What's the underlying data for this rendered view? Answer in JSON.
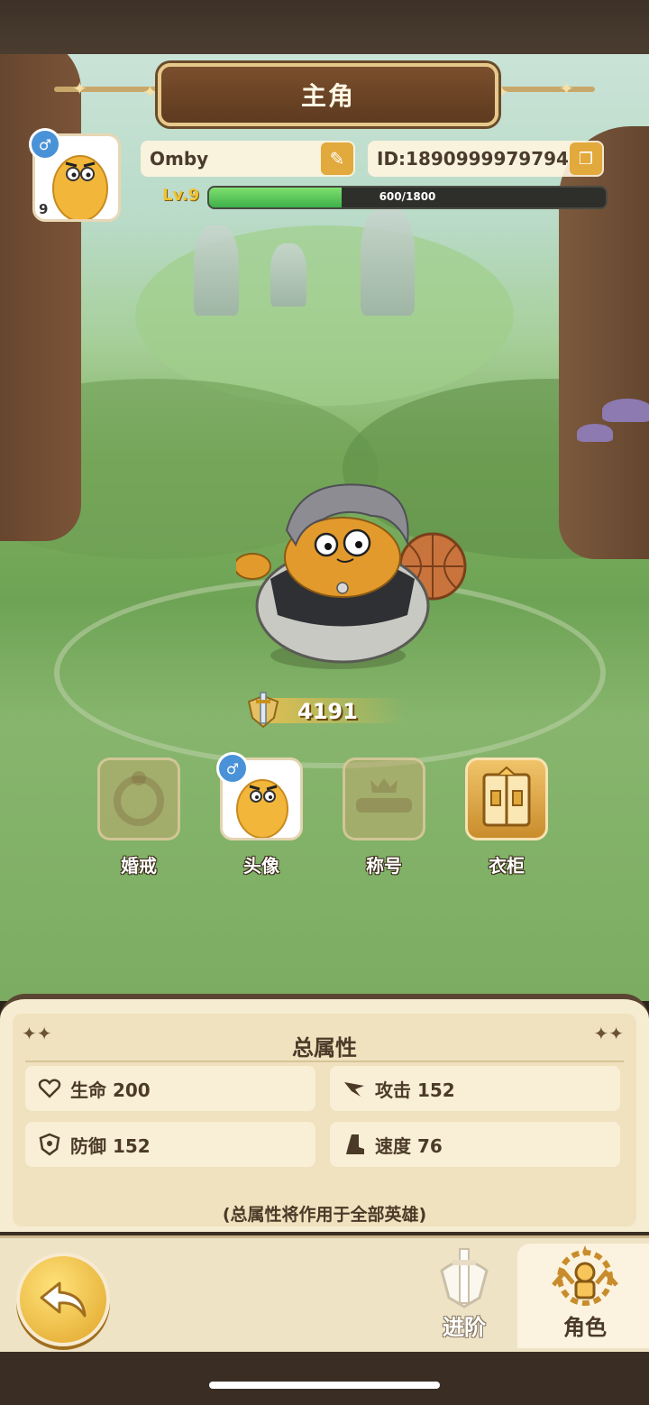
{
  "header": {
    "title": "主角"
  },
  "profile": {
    "name": "Omby",
    "id": "ID:1890999979794",
    "level_label": "Lv.9",
    "avatar_level": "9",
    "gender_symbol": "♂",
    "xp_text": "600/1800",
    "xp_progress": 0.333
  },
  "power": {
    "value": "4191"
  },
  "slots": [
    {
      "label": "婚戒",
      "state": "locked"
    },
    {
      "label": "头像",
      "state": "active"
    },
    {
      "label": "称号",
      "state": "locked"
    },
    {
      "label": "衣柜",
      "state": "available"
    }
  ],
  "stats": {
    "title": "总属性",
    "hp": "生命 200",
    "attack": "攻击 152",
    "defense": "防御 152",
    "speed": "速度 76",
    "note": "(总属性将作用于全部英雄)"
  },
  "nav": {
    "tabs": [
      {
        "label": "进阶",
        "state": "inactive"
      },
      {
        "label": "角色",
        "state": "active"
      }
    ]
  },
  "colors": {
    "accent": "#e2a93c",
    "xp_fill": "#3db04a",
    "gender": "#4a92d8",
    "panel_bg": "#f6ecd2"
  }
}
